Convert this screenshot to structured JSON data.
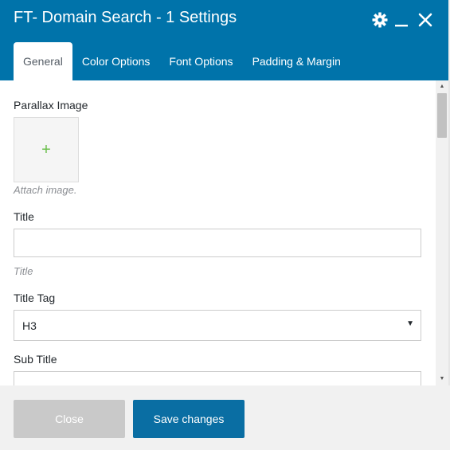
{
  "header": {
    "title": "FT- Domain Search - 1 Settings",
    "icons": [
      "gear-icon",
      "minimize-icon",
      "close-icon"
    ],
    "background": "#0073aa"
  },
  "tabs": [
    {
      "label": "General",
      "active": true
    },
    {
      "label": "Color Options",
      "active": false
    },
    {
      "label": "Font Options",
      "active": false
    },
    {
      "label": "Padding & Margin",
      "active": false
    }
  ],
  "fields": {
    "parallax": {
      "label": "Parallax Image",
      "add_symbol": "+",
      "hint": "Attach image."
    },
    "title": {
      "label": "Title",
      "value": "",
      "hint": "Title"
    },
    "title_tag": {
      "label": "Title Tag",
      "value": "H3",
      "arrow": "▼"
    },
    "sub_title": {
      "label": "Sub Title",
      "value": ""
    }
  },
  "scrollbar": {
    "up": "▲",
    "down": "▼"
  },
  "footer": {
    "close_label": "Close",
    "save_label": "Save changes"
  },
  "colors": {
    "accent": "#0073aa",
    "save_button": "#0a6ea3",
    "close_button": "#c9c9c9",
    "plus": "#6abf4b"
  }
}
